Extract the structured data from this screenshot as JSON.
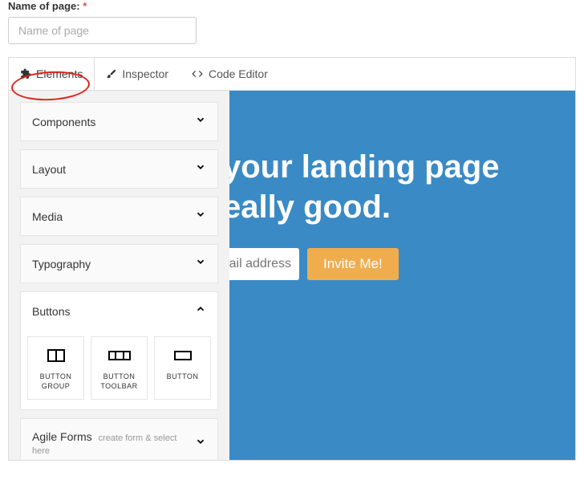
{
  "field": {
    "label": "Name of page:",
    "required": "*",
    "placeholder": "Name of page",
    "value": ""
  },
  "tabs": {
    "elements": "Elements",
    "inspector": "Inspector",
    "code_editor": "Code Editor"
  },
  "sidebar": {
    "panels": {
      "components": "Components",
      "layout": "Layout",
      "media": "Media",
      "typography": "Typography",
      "buttons": "Buttons",
      "agile_forms": "Agile Forms",
      "agile_forms_note": "create form & select here"
    },
    "buttons_blocks": {
      "button_group": "BUTTON GROUP",
      "button_toolbar": "BUTTON TOOLBAR",
      "button": "BUTTON"
    }
  },
  "canvas": {
    "headline_line1": "your landing page",
    "headline_line2": "eally good.",
    "email_placeholder": "ail address",
    "invite_label": "Invite Me!"
  },
  "colors": {
    "canvas_bg": "#3a8ac5",
    "invite_btn": "#f0ad4e",
    "sidebar_bg": "#f2f2f2",
    "annotation": "#d9201a"
  }
}
